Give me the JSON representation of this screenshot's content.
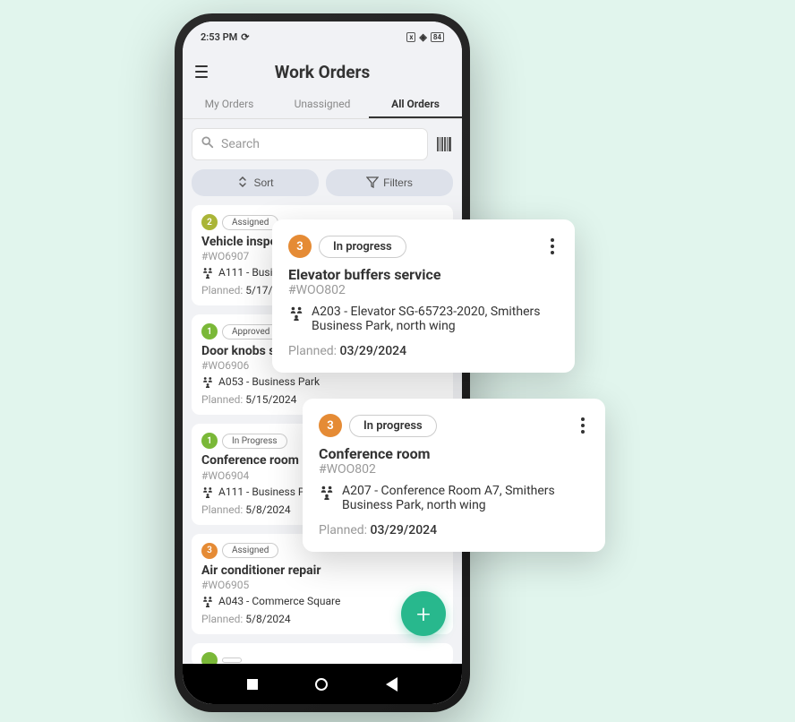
{
  "statusBar": {
    "time": "2:53 PM",
    "battery": "84"
  },
  "header": {
    "title": "Work Orders"
  },
  "tabs": [
    {
      "label": "My Orders"
    },
    {
      "label": "Unassigned"
    },
    {
      "label": "All Orders"
    }
  ],
  "search": {
    "placeholder": "Search"
  },
  "sortButton": {
    "label": "Sort"
  },
  "filterButton": {
    "label": "Filters"
  },
  "plannedLabel": "Planned:",
  "cards": [
    {
      "priority": "2",
      "priorityClass": "priority-2",
      "status": "Assigned",
      "title": "Vehicle inspection",
      "id": "#WO6907",
      "location": "A111 - Business Park",
      "planned": "5/17/2024"
    },
    {
      "priority": "1",
      "priorityClass": "priority-1",
      "status": "Approved",
      "title": "Door knobs swap",
      "id": "#WO6906",
      "location": "A053 - Business Park",
      "planned": "5/15/2024"
    },
    {
      "priority": "1",
      "priorityClass": "priority-1",
      "status": "In Progress",
      "title": "Conference room maintenance",
      "id": "#WO6904",
      "location": "A111 - Business Park",
      "planned": "5/8/2024"
    },
    {
      "priority": "3",
      "priorityClass": "priority-3",
      "status": "Assigned",
      "title": "Air conditioner repair",
      "id": "#WO6905",
      "location": "A043 - Commerce Square",
      "planned": "5/8/2024"
    }
  ],
  "floating": [
    {
      "priority": "3",
      "status": "In progress",
      "title": "Elevator buffers service",
      "id": "#WOO802",
      "location": "A203 - Elevator SG-65723-2020, Smithers Business Park, north wing",
      "planned": "03/29/2024"
    },
    {
      "priority": "3",
      "status": "In progress",
      "title": "Conference room",
      "id": "#WOO802",
      "location": "A207 - Conference Room A7, Smithers Business Park, north wing",
      "planned": "03/29/2024"
    }
  ]
}
